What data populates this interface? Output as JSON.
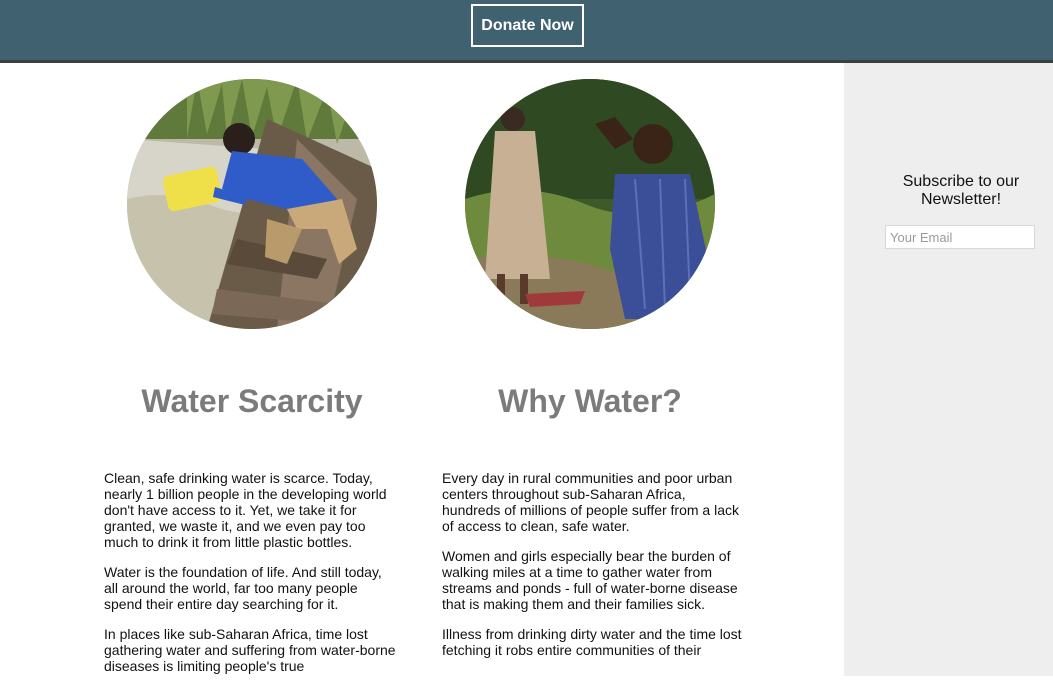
{
  "header": {
    "donate_label": "Donate Now"
  },
  "sidebar": {
    "newsletter_title": "Subscribe to our Newsletter!",
    "email_placeholder": "Your Email"
  },
  "sections": [
    {
      "title": "Water Scarcity",
      "paragraphs": [
        "Clean, safe drinking water is scarce. Today, nearly 1 billion people in the developing world don't have access to it. Yet, we take it for granted, we waste it, and we even pay too much to drink it from little plastic bottles.",
        "Water is the foundation of life. And still today, all around the world, far too many people spend their entire day searching for it.",
        "In places like sub-Saharan Africa, time lost gathering water and suffering from water-borne diseases is limiting people's true"
      ]
    },
    {
      "title": "Why Water?",
      "paragraphs": [
        "Every day in rural communities and poor urban centers throughout sub-Saharan Africa, hundreds of millions of people suffer from a lack of access to clean, safe water.",
        "Women and girls especially bear the burden of walking miles at a time to gather water from streams and ponds - full of water-borne disease that is making them and their families sick.",
        "Illness from drinking dirty water and the time lost fetching it robs entire communities of their"
      ]
    }
  ],
  "colors": {
    "header_bg": "#3f6170",
    "sidebar_bg": "#eeeeee",
    "heading_color": "#7b7b7b"
  }
}
